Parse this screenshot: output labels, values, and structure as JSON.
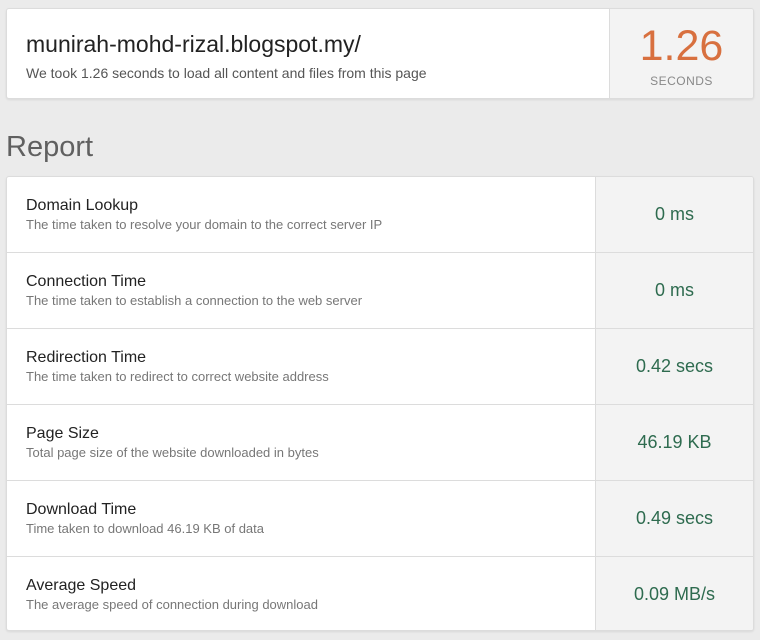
{
  "summary": {
    "url": "munirah-mohd-rizal.blogspot.my/",
    "description": "We took 1.26 seconds to load all content and files from this page",
    "load_time": "1.26",
    "load_time_unit": "SECONDS"
  },
  "report": {
    "heading": "Report",
    "rows": [
      {
        "title": "Domain Lookup",
        "desc": "The time taken to resolve your domain to the correct server IP",
        "value": "0 ms"
      },
      {
        "title": "Connection Time",
        "desc": "The time taken to establish a connection to the web server",
        "value": "0 ms"
      },
      {
        "title": "Redirection Time",
        "desc": "The time taken to redirect to correct website address",
        "value": "0.42 secs"
      },
      {
        "title": "Page Size",
        "desc": "Total page size of the website downloaded in bytes",
        "value": "46.19 KB"
      },
      {
        "title": "Download Time",
        "desc": "Time taken to download 46.19 KB of data",
        "value": "0.49 secs"
      },
      {
        "title": "Average Speed",
        "desc": "The average speed of connection during download",
        "value": "0.09 MB/s"
      }
    ]
  },
  "colors": {
    "accent_time": "#d8703f",
    "value_green": "#2e6b4f",
    "background": "#ebebeb"
  }
}
